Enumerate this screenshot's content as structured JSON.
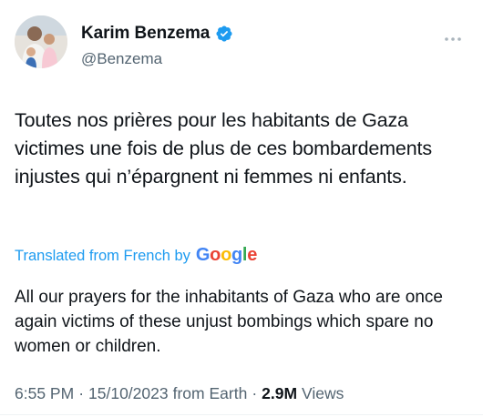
{
  "author": {
    "display_name": "Karim Benzema",
    "handle": "@Benzema",
    "avatar_icon": "profile-photo",
    "verified_icon": "verified-badge-icon",
    "verified_color": "#1d9bf0"
  },
  "menu": {
    "more_icon": "more-horizontal-icon"
  },
  "tweet": {
    "text": "Toutes nos prières pour les habitants de Gaza victimes une fois de plus de ces bombardements injustes qui n’épargnent ni femmes ni enfants."
  },
  "translation": {
    "label": "Translated from French by",
    "provider": {
      "G": "G",
      "o1": "o",
      "o2": "o",
      "g": "g",
      "l": "l",
      "e": "e"
    },
    "text": "All our prayers for the inhabitants of Gaza who are once again victims of these unjust bombings which spare no women or children."
  },
  "meta": {
    "time": "6:55 PM",
    "date": "15/10/2023",
    "source": "from Earth",
    "separator": "·",
    "views_count": "2.9M",
    "views_label": "Views"
  },
  "colors": {
    "text_primary": "#0f1419",
    "text_secondary": "#536471",
    "link": "#1d9bf0"
  }
}
